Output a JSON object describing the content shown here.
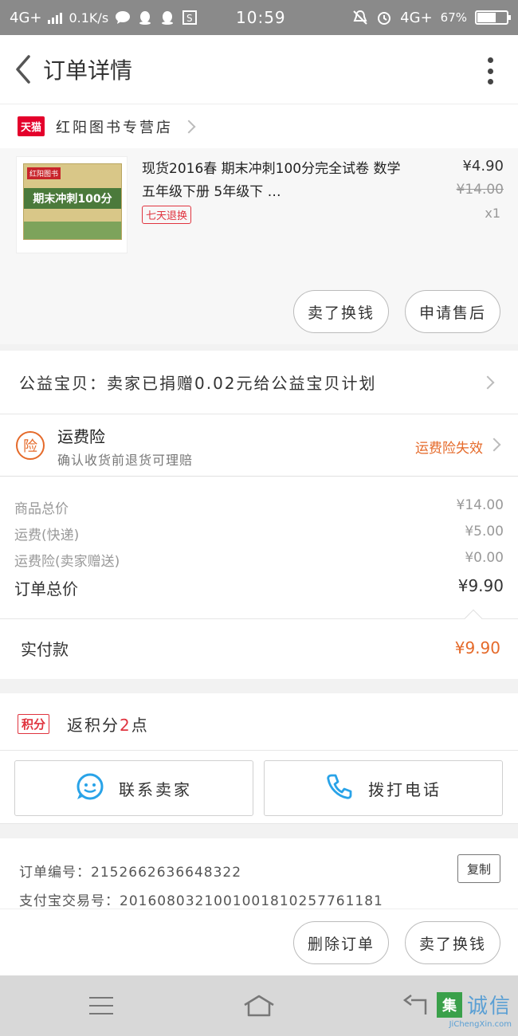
{
  "status_bar": {
    "network": "4G+",
    "speed": "0.1K/s",
    "time": "10:59",
    "network_right": "4G+",
    "battery": "67%"
  },
  "nav": {
    "title": "订单详情"
  },
  "shop": {
    "badge": "天猫",
    "name": "红阳图书专营店"
  },
  "product": {
    "title": "现货2016春 期末冲刺100分完全试卷 数学 五年级下册 5年级下 …",
    "cover_brand": "红阳图书",
    "cover_title": "期末冲刺100分",
    "return_badge": "七天退换",
    "price": "¥4.90",
    "original_price": "¥14.00",
    "quantity": "x1"
  },
  "buttons": {
    "sell_exchange": "卖了换钱",
    "after_sales": "申请售后",
    "delete_order": "删除订单"
  },
  "charity": {
    "text": "公益宝贝：卖家已捐赠0.02元给公益宝贝计划"
  },
  "insurance": {
    "icon_char": "险",
    "title": "运费险",
    "subtitle": "确认收货前退货可理赔",
    "status": "运费险失效"
  },
  "price_summary": {
    "rows": [
      {
        "label": "商品总价",
        "value": "¥14.00"
      },
      {
        "label": "运费(快递)",
        "value": "¥5.00"
      },
      {
        "label": "运费险(卖家赠送)",
        "value": "¥0.00"
      }
    ],
    "total_label": "订单总价",
    "total_value": "¥9.90"
  },
  "payment": {
    "label": "实付款",
    "value": "¥9.90"
  },
  "points": {
    "badge": "积分",
    "prefix": "返积分",
    "count": "2",
    "suffix": "点"
  },
  "contact": {
    "seller": "联系卖家",
    "call": "拨打电话"
  },
  "order_info": {
    "order_no": "订单编号：2152662636648322",
    "alipay_no": "支付宝交易号：2016080321001001810257761181",
    "copy": "复制"
  },
  "watermark": {
    "char": "集",
    "name": "诚信",
    "url": "JiChengXin.com"
  },
  "colors": {
    "accent_orange": "#e56a2a",
    "tmall_red": "#e4002b",
    "contact_blue": "#29a3e8"
  }
}
